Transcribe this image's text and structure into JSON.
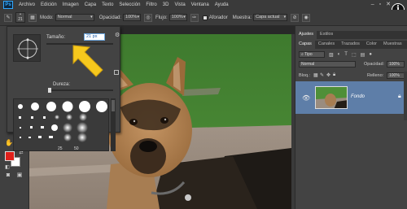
{
  "menubar": {
    "logo": "Ps",
    "items": [
      "Archivo",
      "Edición",
      "Imagen",
      "Capa",
      "Texto",
      "Selección",
      "Filtro",
      "3D",
      "Vista",
      "Ventana",
      "Ayuda"
    ],
    "info_badge": "i"
  },
  "options": {
    "brush_size": "21",
    "mode_label": "Modo:",
    "mode_value": "Normal",
    "opacity_label": "Opacidad:",
    "opacity_value": "100%",
    "flow_label": "Flujo:",
    "flow_value": "100%",
    "airbrush_label": "Aforador",
    "sample_label": "Muestra:",
    "sample_value": "Capa actual"
  },
  "brush_panel": {
    "size_label": "Tamaño:",
    "size_value": "21 px",
    "hardness_label": "Dureza:",
    "preset_numbers": [
      "25",
      "50"
    ]
  },
  "right_panel": {
    "top_tabs": [
      "Ajustes",
      "Estilos"
    ],
    "layer_tabs": [
      "Capas",
      "Canales",
      "Trazados",
      "Color",
      "Muestras"
    ],
    "filter_value": "Tipo",
    "blend_value": "Normal",
    "opacity_label": "Opacidad:",
    "opacity_value": "100%",
    "lock_label": "Bloq.:",
    "fill_label": "Relleno:",
    "fill_value": "100%",
    "layer_name": "Fondo"
  },
  "colors": {
    "foreground": "#e0201b",
    "background": "#ffffff",
    "arrow": "#f6c81d",
    "selected_layer": "#5e7ea8"
  }
}
